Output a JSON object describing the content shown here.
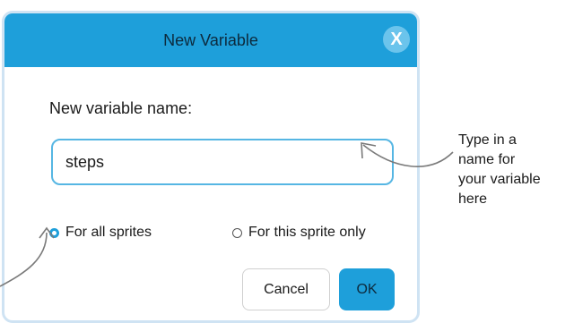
{
  "dialog": {
    "title": "New Variable",
    "close_label": "X",
    "prompt": "New variable name:",
    "input_value": "steps",
    "options": [
      {
        "label": "For all sprites",
        "selected": true
      },
      {
        "label": "For this sprite only",
        "selected": false
      }
    ],
    "cancel_label": "Cancel",
    "ok_label": "OK"
  },
  "annotations": {
    "callout": [
      "Type in a",
      "name for",
      "your variable",
      "here"
    ]
  },
  "colors": {
    "accent": "#1e9fda",
    "input_border": "#56b6e3",
    "dialog_border": "#cfe3f3"
  }
}
